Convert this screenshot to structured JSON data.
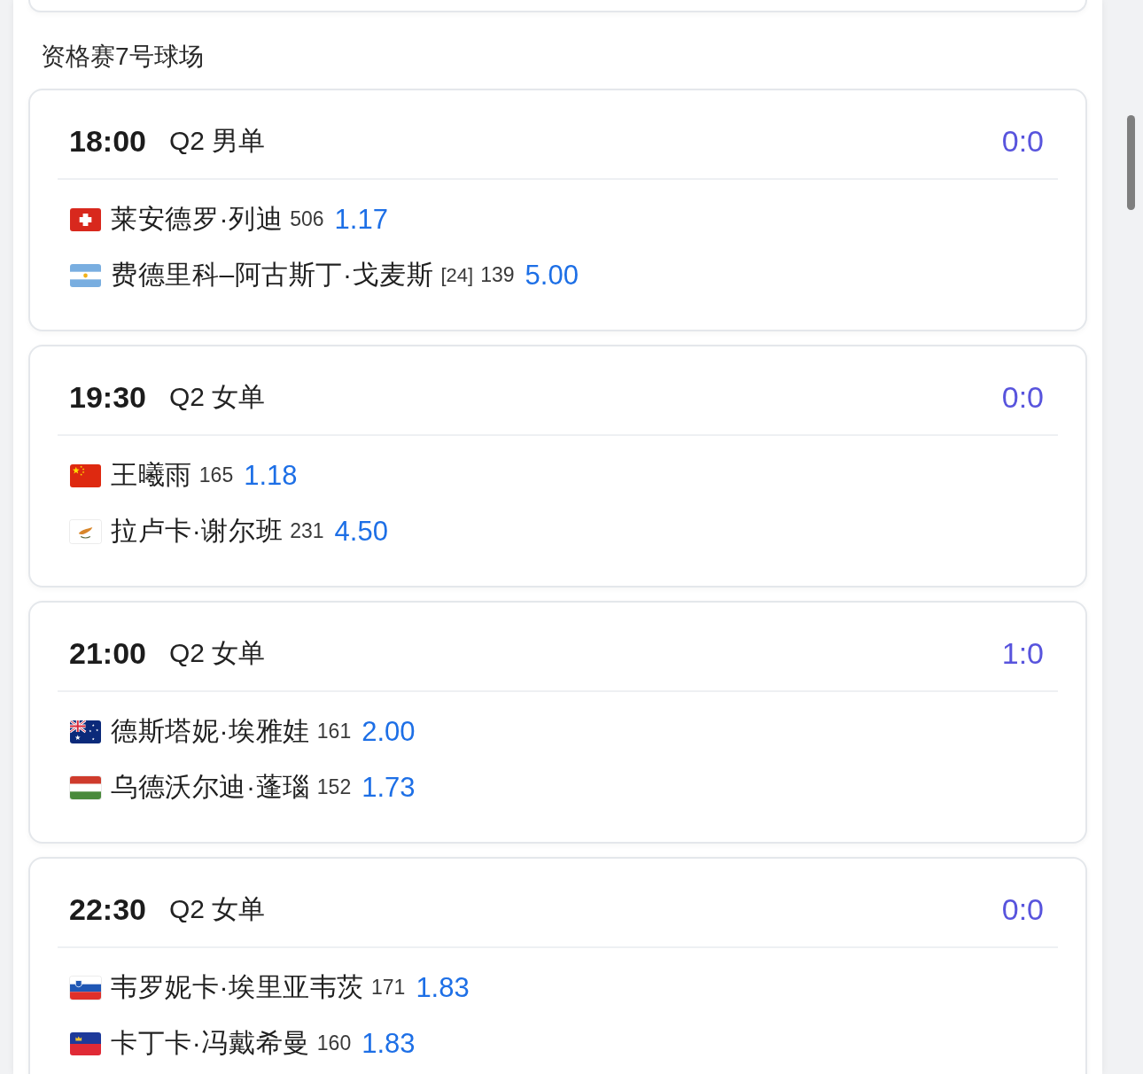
{
  "section_title": "资格赛7号球场",
  "matches": [
    {
      "time": "18:00",
      "event": "Q2 男单",
      "score": "0:0",
      "players": [
        {
          "flag": {
            "kind": "switzerland"
          },
          "name": "莱安德罗·列迪",
          "rank": "506",
          "odds": "1.17"
        },
        {
          "flag": {
            "kind": "argentina"
          },
          "name": "费德里科–阿古斯丁·戈麦斯",
          "seed": "[24]",
          "rank": "139",
          "odds": "5.00"
        }
      ]
    },
    {
      "time": "19:30",
      "event": "Q2 女单",
      "score": "0:0",
      "players": [
        {
          "flag": {
            "kind": "china"
          },
          "name": "王曦雨",
          "rank": "165",
          "odds": "1.18"
        },
        {
          "flag": {
            "kind": "cyprus"
          },
          "name": "拉卢卡·谢尔班",
          "rank": "231",
          "odds": "4.50"
        }
      ]
    },
    {
      "time": "21:00",
      "event": "Q2 女单",
      "score": "1:0",
      "players": [
        {
          "flag": {
            "kind": "australia"
          },
          "name": "德斯塔妮·埃雅娃",
          "rank": "161",
          "odds": "2.00"
        },
        {
          "flag": {
            "kind": "hungary"
          },
          "name": "乌德沃尔迪·蓬瑙",
          "rank": "152",
          "odds": "1.73"
        }
      ]
    },
    {
      "time": "22:30",
      "event": "Q2 女单",
      "score": "0:0",
      "players": [
        {
          "flag": {
            "kind": "slovenia"
          },
          "name": "韦罗妮卡·埃里亚韦茨",
          "rank": "171",
          "odds": "1.83"
        },
        {
          "flag": {
            "kind": "liechtenstein"
          },
          "name": "卡丁卡·冯戴希曼",
          "rank": "160",
          "odds": "1.83"
        }
      ]
    }
  ]
}
